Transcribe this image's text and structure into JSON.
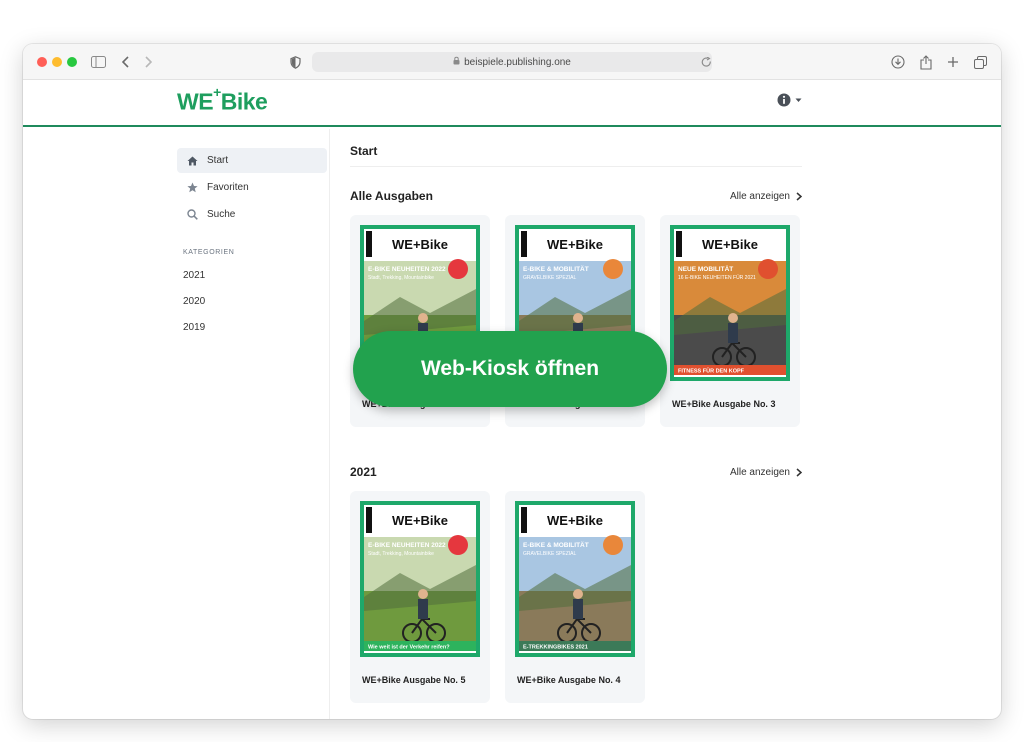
{
  "browser": {
    "url": "beispiele.publishing.one",
    "traffic_lights": [
      "#ff5f57",
      "#febc2e",
      "#28c840"
    ]
  },
  "brand": {
    "logo_main": "WE",
    "logo_sup": "+",
    "logo_tail": "Bike",
    "color": "#1e9e5e"
  },
  "sidebar": {
    "items": [
      {
        "label": "Start",
        "icon": "home-icon"
      },
      {
        "label": "Favoriten",
        "icon": "star-icon"
      },
      {
        "label": "Suche",
        "icon": "search-icon"
      }
    ],
    "categories_heading": "KATEGORIEN",
    "categories": [
      "2021",
      "2020",
      "2019"
    ]
  },
  "main": {
    "breadcrumb": "Start",
    "sections": [
      {
        "title": "Alle Ausgaben",
        "link": "Alle anzeigen",
        "issues": [
          {
            "title": "WE+Bike Ausgabe No. 5",
            "cover": "a"
          },
          {
            "title": "WE+Bike Ausgabe No. 4",
            "cover": "b"
          },
          {
            "title": "WE+Bike Ausgabe No. 3",
            "cover": "c"
          }
        ]
      },
      {
        "title": "2021",
        "link": "Alle anzeigen",
        "issues": [
          {
            "title": "WE+Bike Ausgabe No. 5",
            "cover": "a"
          },
          {
            "title": "WE+Bike Ausgabe No. 4",
            "cover": "b"
          }
        ]
      }
    ]
  },
  "covers": {
    "masthead": "WE+Bike",
    "a": {
      "headline": "E-BIKE NEUHEITEN 2022",
      "sub": "Stadt, Trekking, Mountainbike",
      "banner": "Wie weit ist der Verkehr reifen?"
    },
    "b": {
      "headline": "E-BIKE & MOBILITÄT",
      "sub": "GRAVELBIKE SPEZIAL",
      "banner": "E-TREKKINGBIKES 2021"
    },
    "c": {
      "headline": "NEUE MOBILITÄT",
      "sub": "16 E-BIKE NEUHEITEN FÜR 2021",
      "banner": "FITNESS FÜR DEN KOPF"
    }
  },
  "cta": {
    "label": "Web-Kiosk öffnen",
    "color": "#22a24e"
  }
}
